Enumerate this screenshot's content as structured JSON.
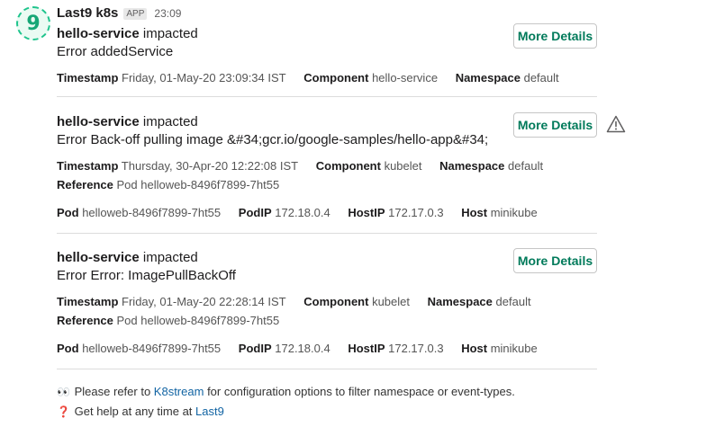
{
  "sender": {
    "name": "Last9 k8s",
    "badge": "APP",
    "time": "23:09",
    "avatar_glyph": "9"
  },
  "buttons": {
    "details_label": "More Details"
  },
  "events": [
    {
      "service": "hello-service",
      "status": "impacted",
      "error": "Error addedService",
      "timestamp_label": "Timestamp",
      "timestamp": "Friday, 01-May-20 23:09:34 IST",
      "component_label": "Component",
      "component": "hello-service",
      "namespace_label": "Namespace",
      "namespace": "default"
    },
    {
      "service": "hello-service",
      "status": "impacted",
      "error": "Error Back-off pulling image &#34;gcr.io/google-samples/hello-app&#34;",
      "timestamp_label": "Timestamp",
      "timestamp": "Thursday, 30-Apr-20 12:22:08 IST",
      "component_label": "Component",
      "component": "kubelet",
      "namespace_label": "Namespace",
      "namespace": "default",
      "reference_label": "Reference",
      "reference": "Pod helloweb-8496f7899-7ht55",
      "pod_label": "Pod",
      "pod": "helloweb-8496f7899-7ht55",
      "podip_label": "PodIP",
      "podip": "172.18.0.4",
      "hostip_label": "HostIP",
      "hostip": "172.17.0.3",
      "host_label": "Host",
      "host": "minikube"
    },
    {
      "service": "hello-service",
      "status": "impacted",
      "error": "Error Error: ImagePullBackOff",
      "timestamp_label": "Timestamp",
      "timestamp": "Friday, 01-May-20 22:28:14 IST",
      "component_label": "Component",
      "component": "kubelet",
      "namespace_label": "Namespace",
      "namespace": "default",
      "reference_label": "Reference",
      "reference": "Pod helloweb-8496f7899-7ht55",
      "pod_label": "Pod",
      "pod": "helloweb-8496f7899-7ht55",
      "podip_label": "PodIP",
      "podip": "172.18.0.4",
      "hostip_label": "HostIP",
      "hostip": "172.17.0.3",
      "host_label": "Host",
      "host": "minikube"
    }
  ],
  "footer": {
    "line1_emoji": "👀",
    "line1_pre": "Please refer to",
    "line1_link": "K8stream",
    "line1_post": "for configuration options to filter namespace or event-types.",
    "line2_emoji": "❓",
    "line2_pre": "Get help at any time at",
    "line2_link": "Last9"
  },
  "icons": {
    "avatar": "last9-logo-icon",
    "warning": "warning-triangle-icon"
  },
  "colors": {
    "accent_green": "#007a5a",
    "link_blue": "#1264a3",
    "logo_green": "#1ec48c"
  }
}
